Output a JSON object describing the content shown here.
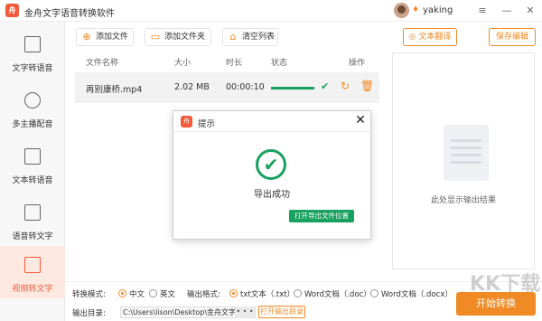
{
  "app": {
    "logo_text": "舟",
    "title": "金舟文字语音转换软件",
    "username": "yaking"
  },
  "window_controls": {
    "menu": "≡",
    "minimize": "—",
    "close": "✕"
  },
  "sidebar": {
    "items": [
      {
        "label": "文字转语音"
      },
      {
        "label": "多主播配音"
      },
      {
        "label": "文本转语音"
      },
      {
        "label": "语音转文字"
      },
      {
        "label": "视频转文字"
      }
    ]
  },
  "toolbar": {
    "add_file": "添加文件",
    "add_folder": "添加文件夹",
    "clear_list": "清空列表",
    "text_translate": "文本翻译",
    "save_edit": "保存编辑"
  },
  "table": {
    "headers": {
      "name": "文件名称",
      "size": "大小",
      "duration": "时长",
      "status": "状态",
      "action": "操作"
    },
    "rows": [
      {
        "name": "再别康桥.mp4",
        "size": "2.02 MB",
        "duration": "00:00:10",
        "progress": 1.0
      }
    ]
  },
  "preview": {
    "placeholder": "此处显示输出结果"
  },
  "modal": {
    "title": "提示",
    "message": "导出成功",
    "open_location": "打开导出文件位置"
  },
  "bottom": {
    "mode_label": "转换模式:",
    "mode_options": [
      "中文",
      "英文"
    ],
    "mode_selected": "中文",
    "format_label": "输出格式:",
    "format_options": [
      "txt文本（.txt）",
      "Word文档（.doc）",
      "Word文档（.docx）"
    ],
    "format_selected": "txt文本（.txt）",
    "output_dir_label": "输出目录:",
    "output_path": "C:\\Users\\lison\\Desktop\\金舟文字语",
    "browse": "• • •",
    "open_output_dir": "打开输出目录",
    "start": "开始转换"
  },
  "watermark": "KK下载",
  "colors": {
    "brand": "#f25a3b",
    "accent": "#f08a24",
    "success": "#19a15f"
  }
}
